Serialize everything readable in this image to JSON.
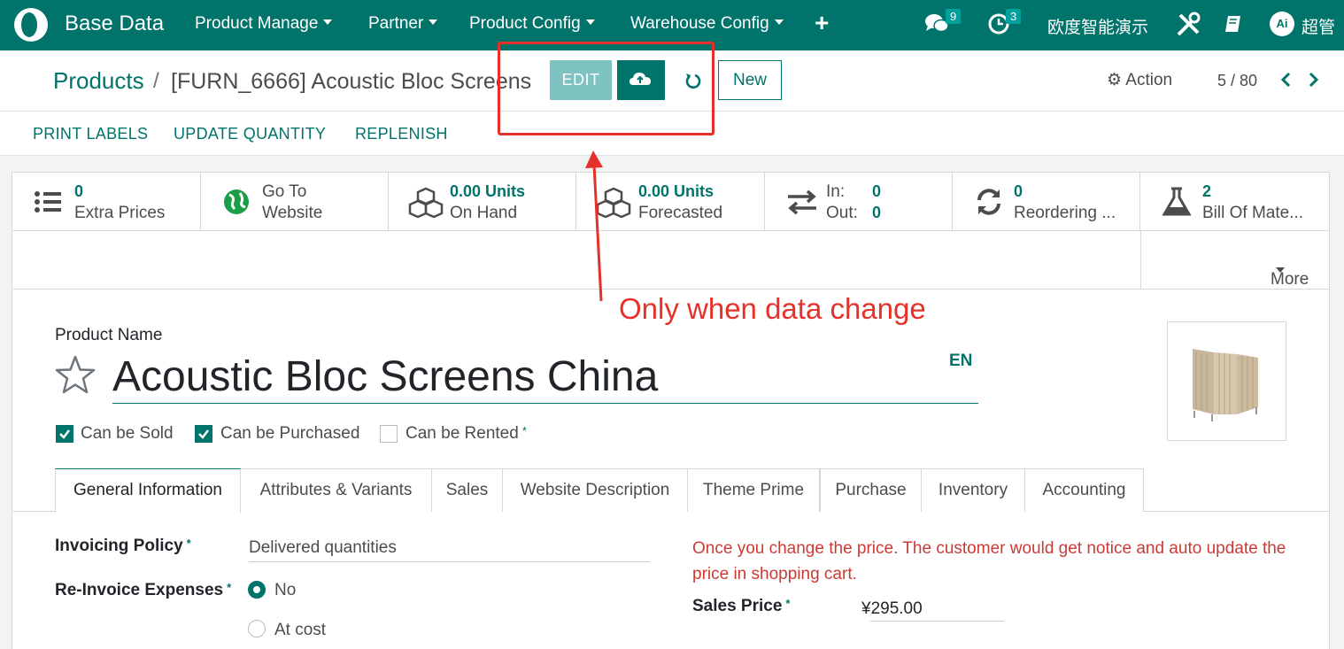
{
  "navbar": {
    "brand": "Base Data",
    "menus": [
      "Product Manage",
      "Partner",
      "Product Config",
      "Warehouse Config"
    ],
    "messages_count": "9",
    "activities_count": "3",
    "company": "欧度智能演示",
    "user_initials": "Ai",
    "user_name": "超管"
  },
  "control_panel": {
    "breadcrumb_parent": "Products",
    "breadcrumb_separator": "/",
    "breadcrumb_current": "[FURN_6666] Acoustic Bloc Screens",
    "edit_label": "EDIT",
    "new_label": "New",
    "action_label": "Action",
    "pager": "5 / 80"
  },
  "status_bar": {
    "buttons": [
      "PRINT LABELS",
      "UPDATE QUANTITY",
      "REPLENISH"
    ]
  },
  "smart_buttons": [
    {
      "value": "0",
      "label": "Extra Prices",
      "icon": "list-icon"
    },
    {
      "value": "Go To",
      "label": "Website",
      "icon": "globe-icon"
    },
    {
      "value": "0.00 Units",
      "label": "On Hand",
      "icon": "cubes-icon"
    },
    {
      "value": "0.00 Units",
      "label": "Forecasted",
      "icon": "cubes-icon"
    },
    {
      "in_label": "In:",
      "in_value": "0",
      "out_label": "Out:",
      "out_value": "0",
      "icon": "exchange-icon"
    },
    {
      "value": "0",
      "label": "Reordering ...",
      "icon": "refresh-icon"
    },
    {
      "value": "2",
      "label": "Bill Of Mate...",
      "icon": "flask-icon"
    }
  ],
  "more_label": "More",
  "annotation": "Only when data change",
  "form": {
    "product_name_label": "Product Name",
    "product_name": "Acoustic Bloc Screens China",
    "lang": "EN",
    "can_be_sold": {
      "label": "Can be Sold",
      "checked": true
    },
    "can_be_purchased": {
      "label": "Can be Purchased",
      "checked": true
    },
    "can_be_rented": {
      "label": "Can be Rented",
      "checked": false,
      "required_mark": "*"
    }
  },
  "tabs": [
    "General Information",
    "Attributes & Variants",
    "Sales",
    "Website Description",
    "Theme Prime",
    "Purchase",
    "Inventory",
    "Accounting"
  ],
  "general": {
    "invoicing_policy_label": "Invoicing Policy",
    "invoicing_policy_value": "Delivered quantities",
    "reinvoice_label": "Re-Invoice Expenses",
    "reinvoice_options": [
      "No",
      "At cost"
    ],
    "reinvoice_selected": "No",
    "required_mark": "*",
    "price_warning": "Once you change the price. The customer would get notice and auto update the price in shopping cart.",
    "sales_price_label": "Sales Price",
    "sales_price_value": "¥295.00"
  },
  "colors": {
    "primary": "#00736a",
    "edit_disabled": "#7ec3c2",
    "annotation": "#e5312a"
  }
}
